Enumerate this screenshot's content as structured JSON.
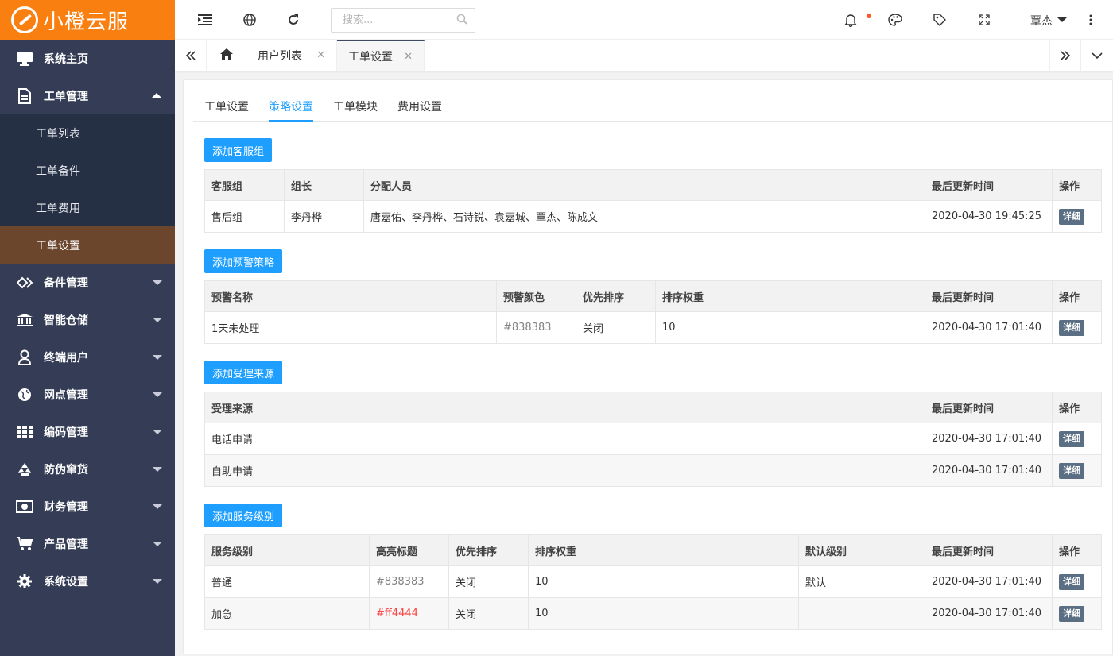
{
  "app": {
    "logo_text": "小橙云服"
  },
  "sidebar": {
    "items": [
      {
        "label": "系统主页",
        "icon": "monitor-icon"
      },
      {
        "label": "工单管理",
        "icon": "document-icon",
        "expanded": true,
        "children": [
          {
            "label": "工单列表"
          },
          {
            "label": "工单备件"
          },
          {
            "label": "工单费用"
          },
          {
            "label": "工单设置",
            "active": true
          }
        ]
      },
      {
        "label": "备件管理",
        "icon": "diamond-link-icon"
      },
      {
        "label": "智能仓储",
        "icon": "bank-icon"
      },
      {
        "label": "终端用户",
        "icon": "user-icon"
      },
      {
        "label": "网点管理",
        "icon": "globe-icon"
      },
      {
        "label": "编码管理",
        "icon": "grid-icon"
      },
      {
        "label": "防伪窜货",
        "icon": "recycle-icon"
      },
      {
        "label": "财务管理",
        "icon": "money-icon"
      },
      {
        "label": "产品管理",
        "icon": "cart-icon"
      },
      {
        "label": "系统设置",
        "icon": "gear-icon"
      }
    ]
  },
  "header": {
    "search_placeholder": "搜索...",
    "user_name": "覃杰"
  },
  "tabs": {
    "items": [
      {
        "label": "用户列表"
      },
      {
        "label": "工单设置",
        "active": true
      }
    ]
  },
  "subtabs": [
    "工单设置",
    "策略设置",
    "工单模块",
    "费用设置"
  ],
  "sections": {
    "groups": {
      "button": "添加客服组",
      "headers": [
        "客服组",
        "组长",
        "分配人员",
        "最后更新时间",
        "操作"
      ],
      "rows": [
        [
          "售后组",
          "李丹桦",
          "唐嘉佑、李丹桦、石诗锐、袁嘉城、覃杰、陈成文",
          "2020-04-30 19:45:25",
          "详细"
        ]
      ]
    },
    "alerts": {
      "button": "添加预警策略",
      "headers": [
        "预警名称",
        "预警颜色",
        "优先排序",
        "排序权重",
        "最后更新时间",
        "操作"
      ],
      "rows": [
        [
          "1天未处理",
          "#838383",
          "关闭",
          "10",
          "2020-04-30 17:01:40",
          "详细"
        ]
      ]
    },
    "sources": {
      "button": "添加受理来源",
      "headers": [
        "受理来源",
        "最后更新时间",
        "操作"
      ],
      "rows": [
        [
          "电话申请",
          "2020-04-30 17:01:40",
          "详细"
        ],
        [
          "自助申请",
          "2020-04-30 17:01:40",
          "详细"
        ]
      ]
    },
    "levels": {
      "button": "添加服务级别",
      "headers": [
        "服务级别",
        "高亮标题",
        "优先排序",
        "排序权重",
        "默认级别",
        "最后更新时间",
        "操作"
      ],
      "rows": [
        [
          "普通",
          "#838383",
          "关闭",
          "10",
          "默认",
          "2020-04-30 17:01:40",
          "详细"
        ],
        [
          "加急",
          "#ff4444",
          "关闭",
          "10",
          "",
          "2020-04-30 17:01:40",
          "详细"
        ]
      ]
    }
  },
  "colors": {
    "brand": "#f87f10",
    "sidebar": "#343d55",
    "accent": "#1e9fff",
    "active_menu": "#6c462c",
    "detail_button": "#5a6f84"
  }
}
